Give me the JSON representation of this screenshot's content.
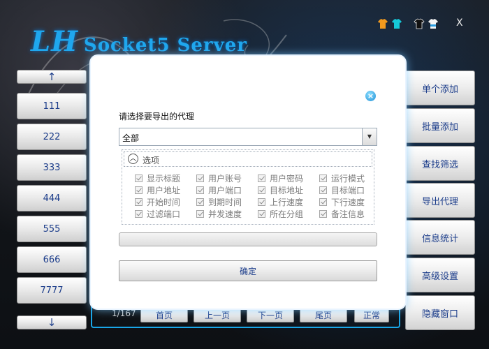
{
  "window": {
    "logo_main": "LH",
    "logo_sub": "Socket5 Server",
    "close_label": "X",
    "skin_icons": [
      "shirt-orange-icon",
      "shirt-cyan-icon",
      "shirt-black-icon",
      "shirt-white-icon"
    ]
  },
  "left_column": {
    "up_arrow": "↑",
    "down_arrow": "↓",
    "items": [
      "111",
      "222",
      "333",
      "444",
      "555",
      "666",
      "7777"
    ]
  },
  "right_column": {
    "buttons": [
      "单个添加",
      "批量添加",
      "查找筛选",
      "导出代理",
      "信息统计",
      "高级设置",
      "隐藏窗口"
    ]
  },
  "pager": {
    "page_info": "1/167",
    "first": "首页",
    "prev": "上一页",
    "next": "下一页",
    "last": "尾页",
    "mode": "正常"
  },
  "dialog": {
    "prompt": "请选择要导出的代理",
    "select_value": "全部",
    "options_title": "选项",
    "options": [
      "显示标题",
      "用户账号",
      "用户密码",
      "运行模式",
      "用户地址",
      "用户端口",
      "目标地址",
      "目标端口",
      "开始时间",
      "到期时间",
      "上行速度",
      "下行速度",
      "过滤端口",
      "并发速度",
      "所在分组",
      "备注信息"
    ],
    "confirm_label": "确定",
    "accent_color": "#1fa7ee"
  }
}
